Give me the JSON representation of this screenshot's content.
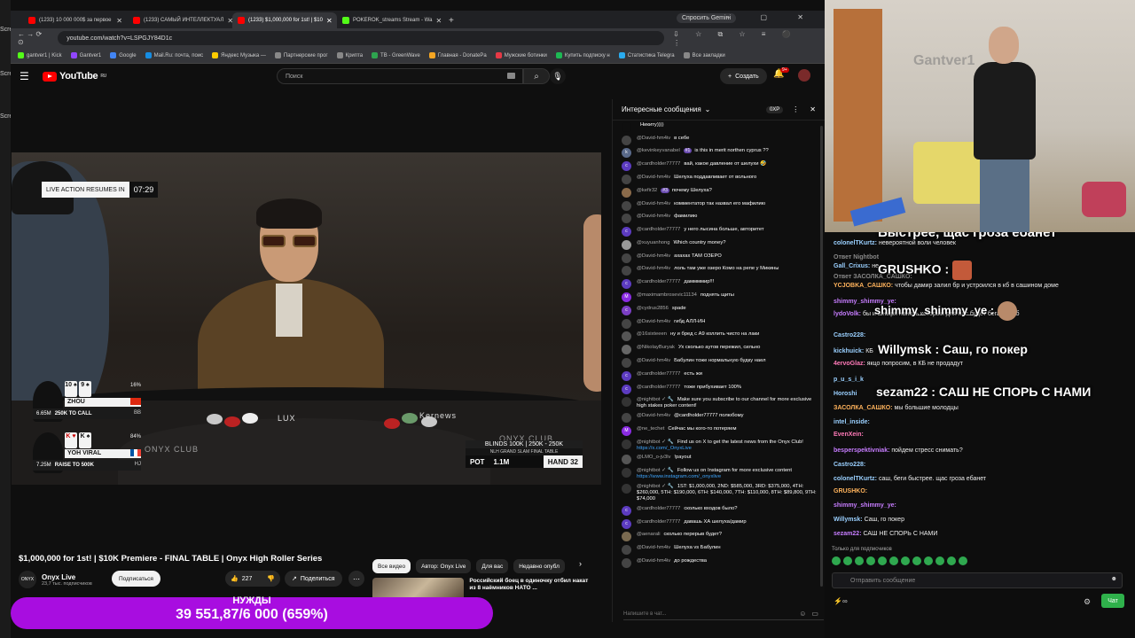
{
  "desktop": {
    "labels": [
      "Scre",
      "Scre",
      "Scre"
    ]
  },
  "browser": {
    "tabs": [
      {
        "title": "(1233) 10 000 000$ за первое",
        "color": "#ff0000",
        "active": false
      },
      {
        "title": "(1233) САМЫЙ ИНТЕЛЛЕКТУАЛ",
        "color": "#ff0000",
        "active": false
      },
      {
        "title": "(1233) $1,000,000 for 1st! | $10",
        "color": "#ff0000",
        "active": true
      },
      {
        "title": "POKEROK_streams Stream - Wa",
        "color": "#53fc18",
        "active": false
      }
    ],
    "new_tab": "+",
    "gemini": "Спросить Gemini",
    "window_controls": "– ▢ ✕",
    "nav": "← → ⟳ ⊙",
    "url": "youtube.com/watch?v=LSPGJY84D1c",
    "addr_icons": "⇩ ☆ ⧉ ☆ ≡ ⚫ ⋮",
    "bookmarks": [
      {
        "label": "gantver1 | Kick",
        "color": "#53fc18"
      },
      {
        "label": "Gantver1",
        "color": "#9146ff"
      },
      {
        "label": "Google",
        "color": "#4285f4"
      },
      {
        "label": "Mail.Ru: почта, поис",
        "color": "#168de2"
      },
      {
        "label": "Яндекс Музыка —",
        "color": "#ffcc00"
      },
      {
        "label": "Партнерские прог",
        "color": "#888888"
      },
      {
        "label": "Крипта",
        "color": "#888888"
      },
      {
        "label": "TB - GreenWave",
        "color": "#2ea44f"
      },
      {
        "label": "Главная - DonatePa",
        "color": "#f5a623"
      },
      {
        "label": "Мужские ботинки",
        "color": "#e63946"
      },
      {
        "label": "Купить подписку н",
        "color": "#1db954"
      },
      {
        "label": "Статистика Telegra",
        "color": "#2aabee"
      },
      {
        "label": "Все закладки",
        "color": "#888888"
      }
    ]
  },
  "youtube": {
    "logo": "YouTube",
    "logo_suffix": "RU",
    "search_placeholder": "Поиск",
    "create": "Создать",
    "notif_count": "9+",
    "video": {
      "live_label": "LIVE ACTION RESUMES IN",
      "timer": "07:29",
      "brand_onyx": "ONYX CLUB",
      "brand_lux": "LUX",
      "brand_kernews": "Kernews",
      "players": [
        {
          "cards": [
            "10 ♠",
            "9 ♠"
          ],
          "pct": "16%",
          "name": "ZHOU",
          "stack": "6.65M",
          "action": "250K TO CALL",
          "pos": "BB"
        },
        {
          "cards": [
            "K ♥",
            "K ♠"
          ],
          "pct": "84%",
          "name": "YOH VIRAL",
          "stack": "7.25M",
          "action": "RAISE TO 500K",
          "pos": "HJ"
        }
      ],
      "blinds": "BLINDS 100K | 250K - 250K",
      "event": "NLH GRAND SLAM FINAL TABLE",
      "pot_label": "POT",
      "pot": "1.1M",
      "hand": "HAND 32"
    },
    "title": "$1,000,000 for 1st! | $10K Premiere - FINAL TABLE | Onyx High Roller Series",
    "channel": {
      "name": "Onyx Live",
      "subs": "23,7 тыс. подписчиков",
      "logo": "ONYX"
    },
    "subscribe": "Подписаться",
    "likes": "227",
    "share": "Поделиться",
    "more": "⋯",
    "filters": [
      "Все видео",
      "Автор: Onyx Live",
      "Для вас",
      "Недавно опубл"
    ],
    "reco_title": "Российский боец в одиночку отбил накат из 8 наёмников НАТО ..."
  },
  "chat": {
    "header": "Интересные сообщения",
    "xp": "0XP",
    "input_placeholder": "Напишите в чат...",
    "messages": [
      {
        "author": "",
        "text": "Никиту))))",
        "avatar": "#0f0f0f",
        "init": ""
      },
      {
        "author": "@David-hm4iv",
        "text": "в себе",
        "avatar": "#444",
        "init": ""
      },
      {
        "author": "@kevinkeyvanabel",
        "badge": "#1",
        "text": "is this in merit northen cyprus ??",
        "avatar": "#5a6a8a",
        "init": "k"
      },
      {
        "author": "@cardholder77777",
        "text": "вай, какое давление от шелухи 🤣",
        "avatar": "#5c3bc0",
        "init": "c"
      },
      {
        "author": "@David-hm4iv",
        "text": "Шелуха поддавливает от вольного",
        "avatar": "#444",
        "init": ""
      },
      {
        "author": "@kefir32",
        "badge": "#3",
        "text": "почему Шелуха?",
        "avatar": "#8a6a4a",
        "init": ""
      },
      {
        "author": "@David-hm4iv",
        "text": "комментатор так назвал его мафилию",
        "avatar": "#444",
        "init": ""
      },
      {
        "author": "@David-hm4iv",
        "text": "фамилию",
        "avatar": "#444",
        "init": ""
      },
      {
        "author": "@cardholder77777",
        "text": "у него лысина больше, авторитет",
        "avatar": "#5c3bc0",
        "init": "c"
      },
      {
        "author": "@xuyuanhong",
        "text": "Which country money?",
        "avatar": "#999",
        "init": ""
      },
      {
        "author": "@David-hm4iv",
        "text": "ахахах ТАМ ОЗЕРО",
        "avatar": "#444",
        "init": ""
      },
      {
        "author": "@David-hm4iv",
        "text": "лоль там уже озеро Комо на репе у Микины",
        "avatar": "#444",
        "init": ""
      },
      {
        "author": "@cardholder77777",
        "text": "даммммир!!!",
        "avatar": "#5c3bc0",
        "init": "c"
      },
      {
        "author": "@maximambrosevic11134",
        "text": "поднять щиты",
        "avatar": "#8a2be2",
        "init": "M"
      },
      {
        "author": "@cydrus2856",
        "text": "spade",
        "avatar": "#7b3fc4",
        "init": "c"
      },
      {
        "author": "@David-hm4iv",
        "text": "гибд АЛЛ-ИН",
        "avatar": "#444",
        "init": ""
      },
      {
        "author": "@16sixteeen",
        "text": "ну и бред с A9 коллить чисто на лаки",
        "avatar": "#555",
        "init": ""
      },
      {
        "author": "@NikolayBuryak",
        "text": "Ух сколько аутов пережил, сильно",
        "avatar": "#666",
        "init": ""
      },
      {
        "author": "@David-hm4iv",
        "text": "Бабулин тоже нормальную будку наел",
        "avatar": "#444",
        "init": ""
      },
      {
        "author": "@cardholder77777",
        "text": "есть жи",
        "avatar": "#5c3bc0",
        "init": "c"
      },
      {
        "author": "@cardholder77777",
        "text": "тоже прибухивает 100%",
        "avatar": "#5c3bc0",
        "init": "c"
      },
      {
        "author": "@nightbot ✓ 🔧",
        "text": "Make sure you subscribe to our channel for more exclusive high stakes poker content!",
        "avatar": "#333",
        "init": "",
        "bot": true
      },
      {
        "author": "@David-hm4iv",
        "text": "@cardholder77777 полюбому",
        "avatar": "#444",
        "init": ""
      },
      {
        "author": "@ne_techet",
        "text": "Сейчас мы кого-то потеряем",
        "avatar": "#8a2be2",
        "init": "M"
      },
      {
        "author": "@nightbot ✓ 🔧",
        "text": "Find us on X to get the latest news from the Onyx Club!",
        "link": "https://x.com/_OnyxLive",
        "avatar": "#333",
        "init": "",
        "bot": true
      },
      {
        "author": "@LMO_o-jv3lv",
        "text": "!payout",
        "avatar": "#555",
        "init": ""
      },
      {
        "author": "@nightbot ✓ 🔧",
        "text": "Follow us on Instagram for more exclusive content",
        "link": "https://www.instagram.com/_onyxlive",
        "avatar": "#333",
        "init": "",
        "bot": true
      },
      {
        "author": "@nightbot ✓ 🔧",
        "text": "1ST: $1,000,000, 2ND: $585,000, 3RD: $375,000, 4TH: $260,000, 5TH: $190,000, 6TH: $140,000, 7TH: $110,000, 8TH: $89,800, 9TH: $74,000",
        "avatar": "#333",
        "init": "",
        "bot": true
      },
      {
        "author": "@cardholder77777",
        "text": "сколько входов было?",
        "avatar": "#5c3bc0",
        "init": "c"
      },
      {
        "author": "@cardholder77777",
        "text": "давашь ХА шелуха/дамир",
        "avatar": "#5c3bc0",
        "init": "c"
      },
      {
        "author": "@aenarali",
        "text": "сколько перерыв будет?",
        "avatar": "#7a6a50",
        "init": ""
      },
      {
        "author": "@David-hm4iv",
        "text": "Шелуха vs Бабулин",
        "avatar": "#444",
        "init": ""
      },
      {
        "author": "@David-hm4iv",
        "text": "до рождества",
        "avatar": "#444",
        "init": ""
      }
    ]
  },
  "stream": {
    "cam_logo": "Gantver1",
    "overlay_top": "Быстрее, щас гроза ебанет",
    "big": [
      {
        "text": "GRUSHKO :"
      },
      {
        "text": "shimmy_shimmy_ye :"
      },
      {
        "text": "Willymsk : Саш, го покер"
      },
      {
        "text": "sezam22 : САШ НЕ СПОРЬ С НАМИ"
      }
    ],
    "messages": [
      {
        "user": "colonelTKurtz:",
        "text": "невероятной воли человек",
        "color": "#9ad0ff"
      },
      {
        "user": "Ответ Nightbot",
        "text": "",
        "color": "#888"
      },
      {
        "user": "Gall_Crixus:",
        "text": "не",
        "color": "#9ad0ff"
      },
      {
        "user": "Ответ ЗАСОЛКА_САШКО:",
        "text": "",
        "color": "#888"
      },
      {
        "user": "YCJOBKA_САШКО:",
        "text": "чтобы дамир залил бр и устроился в кб в сашином доме",
        "color": "#ffb35c"
      },
      {
        "user": "shimmy_shimmy_ye:",
        "text": "",
        "color": "#c77dff"
      },
      {
        "user": "lydoVolk:",
        "text": "бы и шныря нанять который для нас будет бегать в кб",
        "color": "#c77dff"
      },
      {
        "user": "Castro228:",
        "text": "",
        "color": "#9ad0ff"
      },
      {
        "user": "kickhuick:",
        "text": "КБ",
        "color": "#9ad0ff"
      },
      {
        "user": "4ervoGlaz:",
        "text": "якцо попросим, в КБ не продадут",
        "color": "#ff7ab8"
      },
      {
        "user": "p_u_s_i_k",
        "text": "",
        "color": "#9ad0ff"
      },
      {
        "user": "Horoshi",
        "text": "",
        "color": "#9ad0ff"
      },
      {
        "user": "ЗАСОЛКА_САШКО:",
        "text": "мы большие молодцы",
        "color": "#ffb35c"
      },
      {
        "user": "intel_inside:",
        "text": "",
        "color": "#9ad0ff"
      },
      {
        "user": "EvenXein:",
        "text": "",
        "color": "#ff7ab8"
      },
      {
        "user": "besperspektivniak:",
        "text": "пойдем стресс снимать?",
        "color": "#c77dff"
      },
      {
        "user": "Castro228:",
        "text": "",
        "color": "#9ad0ff"
      },
      {
        "user": "colonelTKurtz:",
        "text": "саш, беги быстрее. щас гроза ебанет",
        "color": "#9ad0ff"
      },
      {
        "user": "GRUSHKO:",
        "text": "",
        "color": "#ffb35c"
      },
      {
        "user": "shimmy_shimmy_ye:",
        "text": "",
        "color": "#c77dff"
      },
      {
        "user": "Willymsk:",
        "text": "Саш, го покер",
        "color": "#9ad0ff"
      },
      {
        "user": "sezam22:",
        "text": "САШ НЕ СПОРЬ С НАМИ",
        "color": "#c77dff"
      }
    ],
    "subs_only": "Только для подписчиков",
    "send_placeholder": "Отправить сообщение",
    "bottom_icons": "⚡∞",
    "chat_button": "Чат"
  },
  "donation": {
    "label": "НУЖДЫ",
    "value": "39 551,87/6 000 (659%)"
  }
}
